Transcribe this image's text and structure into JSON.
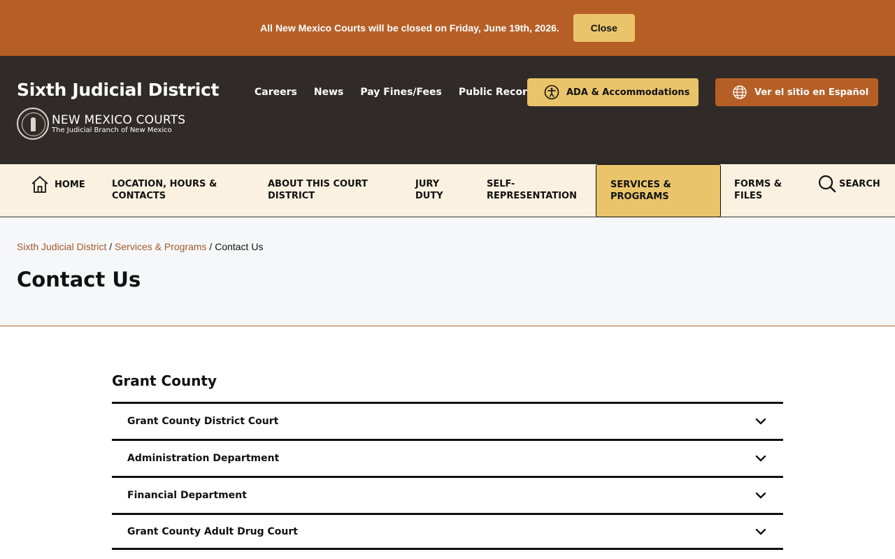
{
  "alert": {
    "message": "All New Mexico Courts will be closed on Friday, June 19th, 2026.",
    "close_label": "Close"
  },
  "header": {
    "site_title": "Sixth Judicial District",
    "logo_name": "NEW MEXICO COURTS",
    "logo_subtitle": "The Judicial Branch of New Mexico",
    "top_links": [
      "Careers",
      "News",
      "Pay Fines/Fees",
      "Public Records"
    ],
    "ada_label": "ADA & Accommodations",
    "spanish_label": "Ver el sitio en Español"
  },
  "nav": {
    "home": "HOME",
    "location": [
      "LOCATION, HOURS &",
      "CONTACTS"
    ],
    "about": [
      "ABOUT THIS COURT",
      "DISTRICT"
    ],
    "jury": [
      "JURY",
      "DUTY"
    ],
    "self_rep": [
      "SELF-",
      "REPRESENTATION"
    ],
    "services": [
      "SERVICES &",
      "PROGRAMS"
    ],
    "forms": [
      "FORMS &",
      "FILES"
    ],
    "search": "SEARCH"
  },
  "breadcrumb": {
    "items": [
      "Sixth Judicial District",
      "Services & Programs"
    ],
    "current": "Contact Us",
    "separator": "/"
  },
  "page_title": "Contact Us",
  "section": {
    "title": "Grant County",
    "items": [
      "Grant County District Court",
      "Administration Department",
      "Financial Department",
      "Grant County Adult Drug Court"
    ]
  },
  "colors": {
    "brand_orange": "#b55f27",
    "header_dark": "#302b28",
    "accent_gold": "#e9c46a",
    "nav_cream": "#faf1e0"
  }
}
